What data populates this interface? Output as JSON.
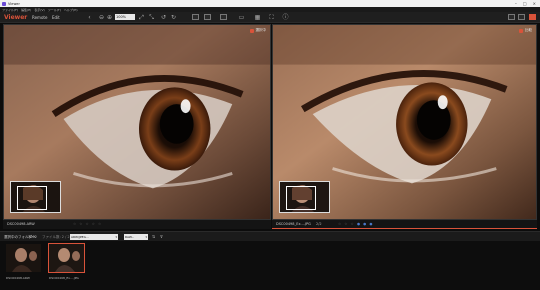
{
  "app": {
    "title": "Viewer"
  },
  "menu": [
    "ファイル(F)",
    "編集(E)",
    "表示(V)",
    "ツール(T)",
    "ヘルプ(H)"
  ],
  "toolbar": {
    "logo": "Viewer",
    "tabs": [
      "Remote",
      "Edit"
    ],
    "zoom": "100%"
  },
  "viewer": {
    "left": {
      "tag": "選択中",
      "filename": "DSC00498.ARW",
      "rating": "☆ ☆ ☆ ☆ ☆"
    },
    "right": {
      "tag": "比較",
      "filename": "DSC00498_Ex....JPG",
      "count": "2/2",
      "rating": "☆ ☆ ☆ ☆ ☆",
      "marks": "● ● ●"
    }
  },
  "filter": {
    "label": "選択中のフォルダー",
    "count": "3002",
    "sub": "ファイル数: 2 / 2",
    "dropdown1": "ARW/JPEG...",
    "dropdown2": "RAW..."
  },
  "filmstrip": [
    {
      "name": "DSC00498.ARW",
      "selected": false
    },
    {
      "name": "DSC00498_Ex....JPG",
      "selected": true
    }
  ],
  "colors": {
    "accent": "#d9533a",
    "bg": "#0c0c0c"
  }
}
